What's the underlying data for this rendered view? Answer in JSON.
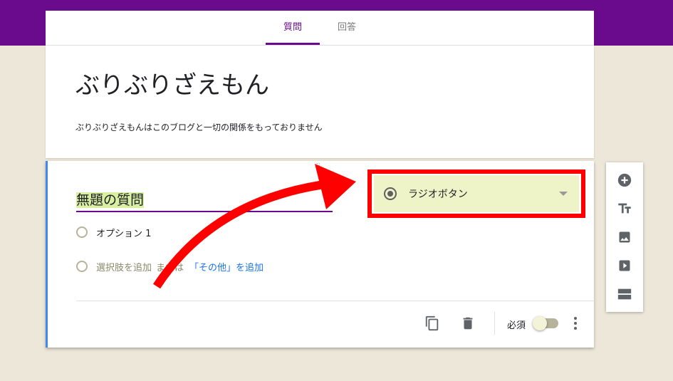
{
  "tabs": {
    "questions": "質問",
    "responses": "回答"
  },
  "form": {
    "title": "ぶりぶりざえもん",
    "description": "ぶりぶりざえもんはこのブログと一切の関係をもっておりません"
  },
  "question": {
    "title": "無題の質問",
    "option_1": "オプション 1",
    "add_option": "選択肢を追加",
    "or": "または",
    "add_other": "「その他」を追加",
    "type": "ラジオボタン",
    "required_label": "必須",
    "required": false
  },
  "side_toolbar": {
    "items": [
      "add-question-icon",
      "add-title-icon",
      "add-image-icon",
      "add-video-icon",
      "add-section-icon"
    ]
  },
  "colors": {
    "theme_purple": "#6a0b8d",
    "background": "#ede7d9",
    "annotation_red": "#ff0000",
    "highlight_yellow": "#d9f0a3"
  }
}
